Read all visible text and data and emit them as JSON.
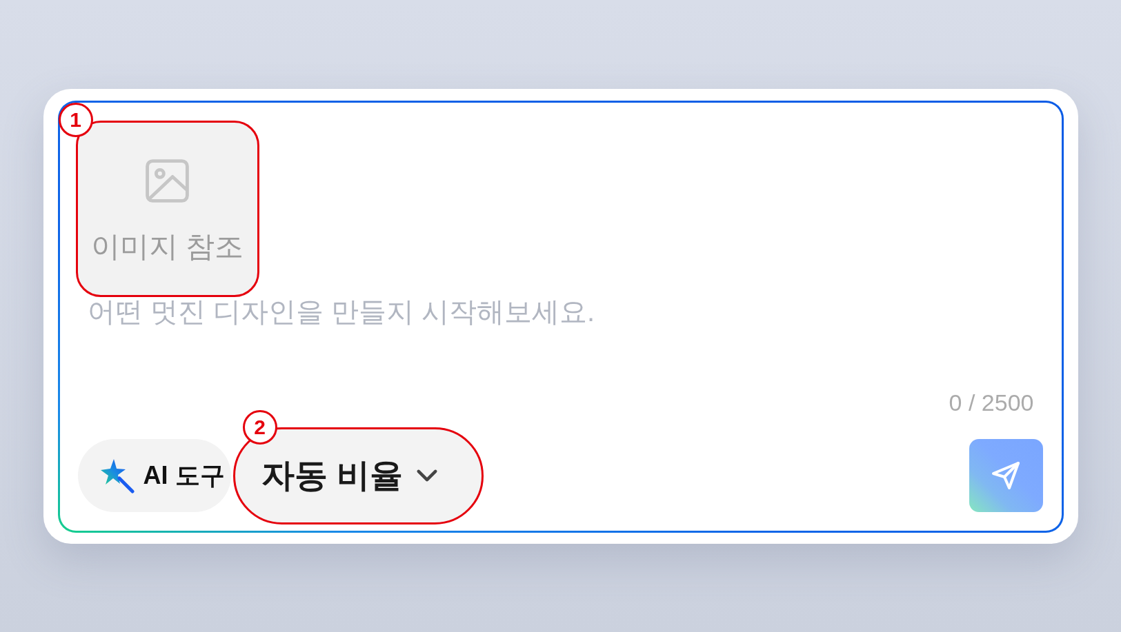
{
  "image_reference": {
    "label": "이미지 참조",
    "callout": "1"
  },
  "prompt": {
    "placeholder": "어떤 멋진 디자인을 만들지 시작해보세요.",
    "counter": "0 / 2500"
  },
  "toolbar": {
    "ai_tools": {
      "label": "AI 도구"
    },
    "aspect_ratio": {
      "label": "자동 비율",
      "callout": "2"
    }
  }
}
